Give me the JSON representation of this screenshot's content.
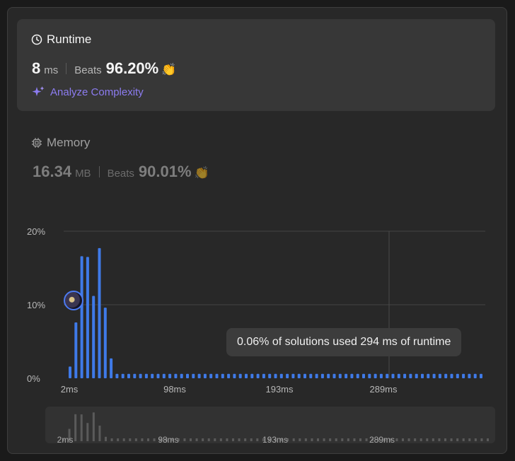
{
  "runtime": {
    "title": "Runtime",
    "value": "8",
    "unit": "ms",
    "beats_label": "Beats",
    "beats_value": "96.20%",
    "analyze_label": "Analyze Complexity"
  },
  "memory": {
    "title": "Memory",
    "value": "16.34",
    "unit": "MB",
    "beats_label": "Beats",
    "beats_value": "90.01%"
  },
  "tooltip": {
    "text": "0.06% of solutions used 294 ms of runtime"
  },
  "colors": {
    "bar": "#3f7ae8",
    "mini_bar": "#5a5a5a",
    "accent": "#8c7cf0",
    "clap": "#3aa655"
  },
  "chart_data": {
    "type": "bar",
    "y_ticks": [
      "20%",
      "10%",
      "0%"
    ],
    "x_ticks": [
      "2ms",
      "98ms",
      "193ms",
      "289ms"
    ],
    "ylim": [
      0,
      20
    ],
    "grid": true,
    "highlight_x_label": "289ms",
    "values": [
      1.6,
      7.6,
      16.6,
      16.5,
      11.2,
      17.7,
      9.6,
      2.7,
      0.6,
      0.6,
      0.6,
      0.6,
      0.6,
      0.6,
      0.6,
      0.6,
      0.6,
      0.6,
      0.6,
      0.6,
      0.6,
      0.6,
      0.6,
      0.6,
      0.6,
      0.6,
      0.6,
      0.6,
      0.6,
      0.6,
      0.6,
      0.6,
      0.6,
      0.6,
      0.6,
      0.6,
      0.6,
      0.6,
      0.6,
      0.6,
      0.6,
      0.6,
      0.6,
      0.6,
      0.6,
      0.6,
      0.6,
      0.6,
      0.6,
      0.6,
      0.6,
      0.6,
      0.6,
      0.6,
      0.6,
      0.6,
      0.6,
      0.6,
      0.6,
      0.6,
      0.6,
      0.6,
      0.6,
      0.6,
      0.6,
      0.6,
      0.6,
      0.6,
      0.6,
      0.6,
      0.6
    ],
    "mini_x_ticks": [
      "2ms",
      "98ms",
      "193ms",
      "289ms"
    ]
  }
}
